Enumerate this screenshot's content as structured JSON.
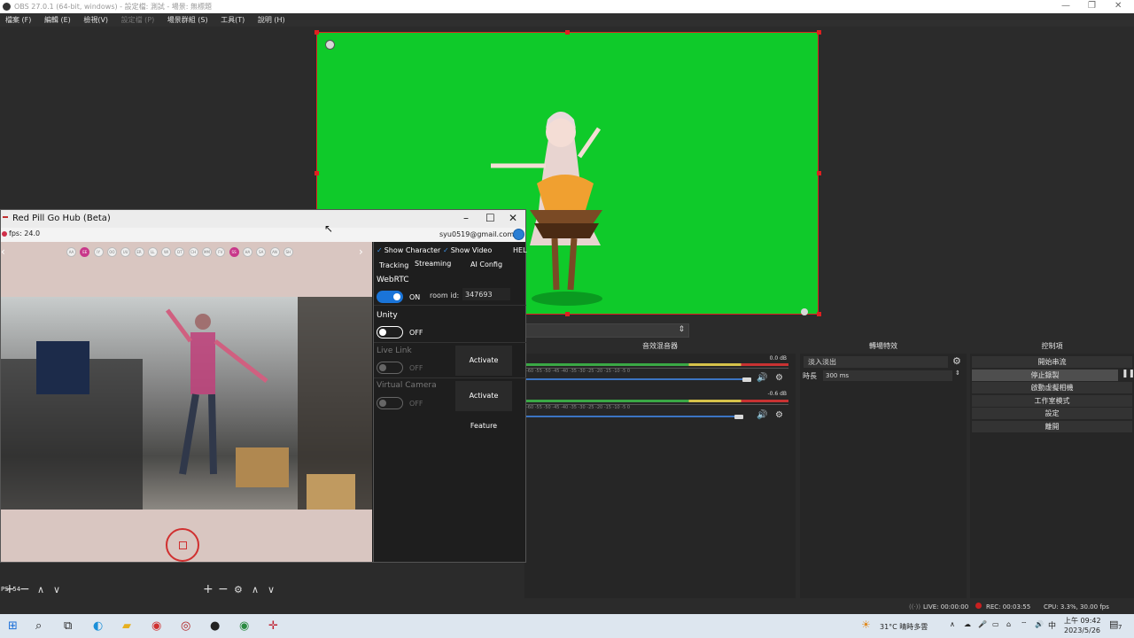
{
  "obs": {
    "title": "OBS 27.0.1 (64-bit, windows) - 設定檔: 測試 - 場景: 無標題",
    "window_controls": [
      "—",
      "❐",
      "✕"
    ],
    "menu": [
      "檔案 (F)",
      "編輯 (E)",
      "檢視(V)",
      "設定檔 (P)",
      "場景群組 (S)",
      "工具(T)",
      "說明 (H)"
    ],
    "docks": {
      "mixer_title": "音效混音器",
      "transitions_title": "轉場特效",
      "controls_title": "控制項"
    },
    "mixer": {
      "tracks": [
        {
          "db": "0.0 dB",
          "fader": 0.83
        },
        {
          "db": "-0.6 dB",
          "fader": 0.8
        }
      ],
      "scale": "-60 -55 -50 -45 -40 -35 -30 -25 -20 -15 -10 -5 0"
    },
    "transitions": {
      "selected": "淡入淡出",
      "duration_label": "時長",
      "duration": "300 ms"
    },
    "controls": [
      "開始串流",
      "停止錄製",
      "啟動虛擬相機",
      "工作室模式",
      "設定",
      "離開"
    ],
    "status": {
      "live": "LIVE: 00:00:00",
      "rec": "REC: 00:03:55",
      "cpu": "CPU: 3.3%, 30.00 fps"
    }
  },
  "redpill": {
    "title": "Red Pill Go Hub (Beta)",
    "fps": "fps: 24.0",
    "email": "syu0519@gmail.com",
    "blendshapes": [
      "AA",
      "EE",
      "IY",
      "OO",
      "UU",
      "ER",
      "LL",
      "WI",
      "DT",
      "CH",
      "MM",
      "FV",
      "SS",
      "HA",
      "SA",
      "AN",
      "SH"
    ],
    "active_blendshapes": [
      1,
      12
    ],
    "fps_bottom": "PS: 54",
    "panel": {
      "show_character": "Show Character",
      "show_video": "Show Video",
      "help": "HEL",
      "tabs": [
        "Tracking",
        "Streaming",
        "AI Config"
      ],
      "webrtc": {
        "label": "WebRTC",
        "state": "ON",
        "room_label": "room id:",
        "room_id": "347693"
      },
      "unity": {
        "label": "Unity",
        "state": "OFF"
      },
      "live_link": {
        "label": "Live Link",
        "state": "OFF",
        "button": "Activate Feature"
      },
      "virtual_camera": {
        "label": "Virtual Camera",
        "state": "OFF",
        "button": "Activate Feature"
      }
    }
  },
  "taskbar": {
    "weather": "31°C 晴時多雲",
    "ime": "中",
    "time": "上午 09:42",
    "date": "2023/5/26",
    "notifications": "7"
  }
}
